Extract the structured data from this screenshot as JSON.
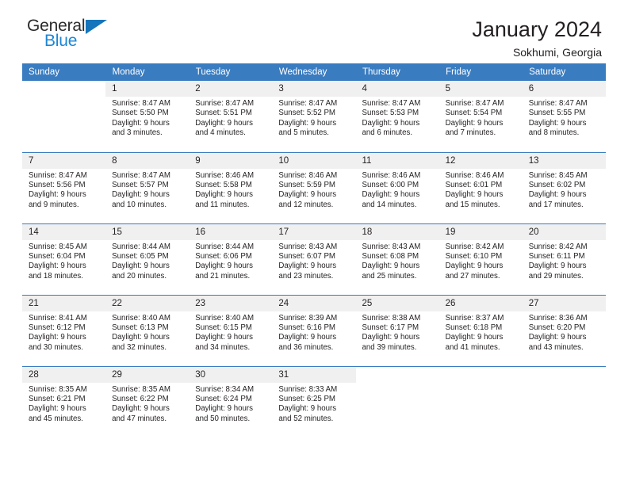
{
  "brand": {
    "name_top": "General",
    "name_bottom": "Blue",
    "triangle_color": "#1574bb",
    "blue_color": "#1c86d4"
  },
  "header": {
    "title": "January 2024",
    "subtitle": "Sokhumi, Georgia"
  },
  "theme": {
    "header_row_bg": "#3a7cc0",
    "daynum_bg": "#f0f0f0",
    "text_color": "#231f20"
  },
  "weekdays": [
    "Sunday",
    "Monday",
    "Tuesday",
    "Wednesday",
    "Thursday",
    "Friday",
    "Saturday"
  ],
  "weeks": [
    [
      {
        "day": "",
        "sunrise": "",
        "sunset": "",
        "daylight1": "",
        "daylight2": ""
      },
      {
        "day": "1",
        "sunrise": "Sunrise: 8:47 AM",
        "sunset": "Sunset: 5:50 PM",
        "daylight1": "Daylight: 9 hours",
        "daylight2": "and 3 minutes."
      },
      {
        "day": "2",
        "sunrise": "Sunrise: 8:47 AM",
        "sunset": "Sunset: 5:51 PM",
        "daylight1": "Daylight: 9 hours",
        "daylight2": "and 4 minutes."
      },
      {
        "day": "3",
        "sunrise": "Sunrise: 8:47 AM",
        "sunset": "Sunset: 5:52 PM",
        "daylight1": "Daylight: 9 hours",
        "daylight2": "and 5 minutes."
      },
      {
        "day": "4",
        "sunrise": "Sunrise: 8:47 AM",
        "sunset": "Sunset: 5:53 PM",
        "daylight1": "Daylight: 9 hours",
        "daylight2": "and 6 minutes."
      },
      {
        "day": "5",
        "sunrise": "Sunrise: 8:47 AM",
        "sunset": "Sunset: 5:54 PM",
        "daylight1": "Daylight: 9 hours",
        "daylight2": "and 7 minutes."
      },
      {
        "day": "6",
        "sunrise": "Sunrise: 8:47 AM",
        "sunset": "Sunset: 5:55 PM",
        "daylight1": "Daylight: 9 hours",
        "daylight2": "and 8 minutes."
      }
    ],
    [
      {
        "day": "7",
        "sunrise": "Sunrise: 8:47 AM",
        "sunset": "Sunset: 5:56 PM",
        "daylight1": "Daylight: 9 hours",
        "daylight2": "and 9 minutes."
      },
      {
        "day": "8",
        "sunrise": "Sunrise: 8:47 AM",
        "sunset": "Sunset: 5:57 PM",
        "daylight1": "Daylight: 9 hours",
        "daylight2": "and 10 minutes."
      },
      {
        "day": "9",
        "sunrise": "Sunrise: 8:46 AM",
        "sunset": "Sunset: 5:58 PM",
        "daylight1": "Daylight: 9 hours",
        "daylight2": "and 11 minutes."
      },
      {
        "day": "10",
        "sunrise": "Sunrise: 8:46 AM",
        "sunset": "Sunset: 5:59 PM",
        "daylight1": "Daylight: 9 hours",
        "daylight2": "and 12 minutes."
      },
      {
        "day": "11",
        "sunrise": "Sunrise: 8:46 AM",
        "sunset": "Sunset: 6:00 PM",
        "daylight1": "Daylight: 9 hours",
        "daylight2": "and 14 minutes."
      },
      {
        "day": "12",
        "sunrise": "Sunrise: 8:46 AM",
        "sunset": "Sunset: 6:01 PM",
        "daylight1": "Daylight: 9 hours",
        "daylight2": "and 15 minutes."
      },
      {
        "day": "13",
        "sunrise": "Sunrise: 8:45 AM",
        "sunset": "Sunset: 6:02 PM",
        "daylight1": "Daylight: 9 hours",
        "daylight2": "and 17 minutes."
      }
    ],
    [
      {
        "day": "14",
        "sunrise": "Sunrise: 8:45 AM",
        "sunset": "Sunset: 6:04 PM",
        "daylight1": "Daylight: 9 hours",
        "daylight2": "and 18 minutes."
      },
      {
        "day": "15",
        "sunrise": "Sunrise: 8:44 AM",
        "sunset": "Sunset: 6:05 PM",
        "daylight1": "Daylight: 9 hours",
        "daylight2": "and 20 minutes."
      },
      {
        "day": "16",
        "sunrise": "Sunrise: 8:44 AM",
        "sunset": "Sunset: 6:06 PM",
        "daylight1": "Daylight: 9 hours",
        "daylight2": "and 21 minutes."
      },
      {
        "day": "17",
        "sunrise": "Sunrise: 8:43 AM",
        "sunset": "Sunset: 6:07 PM",
        "daylight1": "Daylight: 9 hours",
        "daylight2": "and 23 minutes."
      },
      {
        "day": "18",
        "sunrise": "Sunrise: 8:43 AM",
        "sunset": "Sunset: 6:08 PM",
        "daylight1": "Daylight: 9 hours",
        "daylight2": "and 25 minutes."
      },
      {
        "day": "19",
        "sunrise": "Sunrise: 8:42 AM",
        "sunset": "Sunset: 6:10 PM",
        "daylight1": "Daylight: 9 hours",
        "daylight2": "and 27 minutes."
      },
      {
        "day": "20",
        "sunrise": "Sunrise: 8:42 AM",
        "sunset": "Sunset: 6:11 PM",
        "daylight1": "Daylight: 9 hours",
        "daylight2": "and 29 minutes."
      }
    ],
    [
      {
        "day": "21",
        "sunrise": "Sunrise: 8:41 AM",
        "sunset": "Sunset: 6:12 PM",
        "daylight1": "Daylight: 9 hours",
        "daylight2": "and 30 minutes."
      },
      {
        "day": "22",
        "sunrise": "Sunrise: 8:40 AM",
        "sunset": "Sunset: 6:13 PM",
        "daylight1": "Daylight: 9 hours",
        "daylight2": "and 32 minutes."
      },
      {
        "day": "23",
        "sunrise": "Sunrise: 8:40 AM",
        "sunset": "Sunset: 6:15 PM",
        "daylight1": "Daylight: 9 hours",
        "daylight2": "and 34 minutes."
      },
      {
        "day": "24",
        "sunrise": "Sunrise: 8:39 AM",
        "sunset": "Sunset: 6:16 PM",
        "daylight1": "Daylight: 9 hours",
        "daylight2": "and 36 minutes."
      },
      {
        "day": "25",
        "sunrise": "Sunrise: 8:38 AM",
        "sunset": "Sunset: 6:17 PM",
        "daylight1": "Daylight: 9 hours",
        "daylight2": "and 39 minutes."
      },
      {
        "day": "26",
        "sunrise": "Sunrise: 8:37 AM",
        "sunset": "Sunset: 6:18 PM",
        "daylight1": "Daylight: 9 hours",
        "daylight2": "and 41 minutes."
      },
      {
        "day": "27",
        "sunrise": "Sunrise: 8:36 AM",
        "sunset": "Sunset: 6:20 PM",
        "daylight1": "Daylight: 9 hours",
        "daylight2": "and 43 minutes."
      }
    ],
    [
      {
        "day": "28",
        "sunrise": "Sunrise: 8:35 AM",
        "sunset": "Sunset: 6:21 PM",
        "daylight1": "Daylight: 9 hours",
        "daylight2": "and 45 minutes."
      },
      {
        "day": "29",
        "sunrise": "Sunrise: 8:35 AM",
        "sunset": "Sunset: 6:22 PM",
        "daylight1": "Daylight: 9 hours",
        "daylight2": "and 47 minutes."
      },
      {
        "day": "30",
        "sunrise": "Sunrise: 8:34 AM",
        "sunset": "Sunset: 6:24 PM",
        "daylight1": "Daylight: 9 hours",
        "daylight2": "and 50 minutes."
      },
      {
        "day": "31",
        "sunrise": "Sunrise: 8:33 AM",
        "sunset": "Sunset: 6:25 PM",
        "daylight1": "Daylight: 9 hours",
        "daylight2": "and 52 minutes."
      },
      {
        "day": "",
        "sunrise": "",
        "sunset": "",
        "daylight1": "",
        "daylight2": ""
      },
      {
        "day": "",
        "sunrise": "",
        "sunset": "",
        "daylight1": "",
        "daylight2": ""
      },
      {
        "day": "",
        "sunrise": "",
        "sunset": "",
        "daylight1": "",
        "daylight2": ""
      }
    ]
  ]
}
